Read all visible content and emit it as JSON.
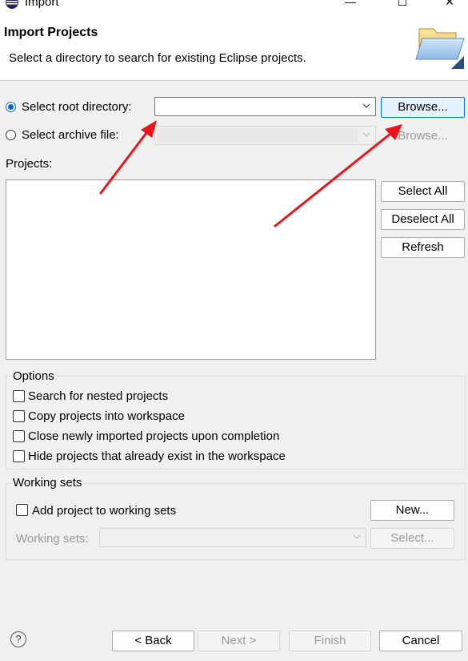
{
  "window": {
    "title": "Import",
    "minimize": "—",
    "maximize": "☐",
    "close": "✕"
  },
  "header": {
    "title": "Import Projects",
    "message": "Select a directory to search for existing Eclipse projects."
  },
  "source": {
    "root_label": "Select root directory:",
    "root_value": "",
    "archive_label": "Select archive file:",
    "browse_root": "Browse...",
    "browse_archive": "Browse..."
  },
  "projects": {
    "label": "Projects:",
    "select_all": "Select All",
    "deselect_all": "Deselect All",
    "refresh": "Refresh"
  },
  "options": {
    "title": "Options",
    "items": [
      "Search for nested projects",
      "Copy projects into workspace",
      "Close newly imported projects upon completion",
      "Hide projects that already exist in the workspace"
    ]
  },
  "working_sets": {
    "title": "Working sets",
    "add_label": "Add project to working sets",
    "new_button": "New...",
    "sets_label": "Working sets:",
    "select_button": "Select..."
  },
  "footer": {
    "help": "?",
    "back": "< Back",
    "next": "Next >",
    "finish": "Finish",
    "cancel": "Cancel"
  },
  "colors": {
    "accent": "#0078d7",
    "annotation_arrow": "#e8151b"
  }
}
